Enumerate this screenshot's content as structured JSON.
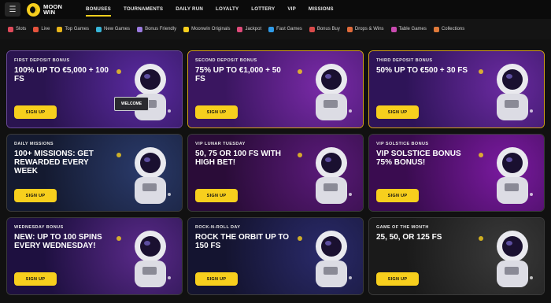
{
  "nav": {
    "logo_line1": "MOON",
    "logo_line2": "WIN",
    "menu_icon": "☰",
    "items": [
      "BONUSES",
      "TOURNAMENTS",
      "DAILY RUN",
      "LOYALTY",
      "LOTTERY",
      "VIP",
      "MISSIONS"
    ],
    "active_index": 0
  },
  "categories": [
    {
      "label": "Slots",
      "icon": "slots-icon",
      "color": "#e04a5a"
    },
    {
      "label": "Live",
      "icon": "live-icon",
      "color": "#e5533d"
    },
    {
      "label": "Top Games",
      "icon": "top-games-icon",
      "color": "#e8b51a"
    },
    {
      "label": "New Games",
      "icon": "new-games-icon",
      "color": "#38b6d8"
    },
    {
      "label": "Bonus Friendly",
      "icon": "bonus-friendly-icon",
      "color": "#9b7ae0"
    },
    {
      "label": "Moonwin Originals",
      "icon": "moonwin-originals-icon",
      "color": "#f7cf1d"
    },
    {
      "label": "Jackpot",
      "icon": "jackpot-icon",
      "color": "#e04a7a"
    },
    {
      "label": "Fast Games",
      "icon": "fast-games-icon",
      "color": "#2f9be8"
    },
    {
      "label": "Bonus Buy",
      "icon": "bonus-buy-icon",
      "color": "#d94a4a"
    },
    {
      "label": "Drops & Wins",
      "icon": "drops-wins-icon",
      "color": "#e06a3a"
    },
    {
      "label": "Table Games",
      "icon": "table-games-icon",
      "color": "#c94ab0"
    },
    {
      "label": "Collections",
      "icon": "collections-icon",
      "color": "#e07a3a"
    }
  ],
  "cards": [
    {
      "subtitle": "FIRST DEPOSIT BONUS",
      "title": "100% UP TO €5,000 + 100 FS",
      "button": "SIGN UP",
      "art_label": "WELCOME",
      "bg": "#5a2aa0",
      "bg2": "#2a1450",
      "border": "#6a4a9a"
    },
    {
      "subtitle": "SECOND DEPOSIT BONUS",
      "title": "75% UP TO €1,000 + 50 FS",
      "button": "SIGN UP",
      "art_label": "",
      "bg": "#7a2aa8",
      "bg2": "#3a1660",
      "border": "#d2a01a"
    },
    {
      "subtitle": "THIRD DEPOSIT BONUS",
      "title": "50% UP TO €500 + 30 FS",
      "button": "SIGN UP",
      "art_label": "",
      "bg": "#6a2aa0",
      "bg2": "#2e1458",
      "border": "#d2a01a"
    },
    {
      "subtitle": "DAILY MISSIONS",
      "title": "100+ MISSIONS: GET REWARDED EVERY WEEK",
      "button": "SIGN UP",
      "art_label": "",
      "bg": "#2a3a6a",
      "bg2": "#141a30",
      "border": "#3a3a3a"
    },
    {
      "subtitle": "VIP LUNAR TUESDAY",
      "title": "50, 75 OR 100 FS WITH HIGH BET!",
      "button": "SIGN UP",
      "art_label": "",
      "bg": "#5a1a7a",
      "bg2": "#2a0c38",
      "border": "#3a3a3a"
    },
    {
      "subtitle": "VIP SOLSTICE BONUS",
      "title": "VIP SOLSTICE BONUS 75% BONUS!",
      "button": "SIGN UP",
      "art_label": "",
      "bg": "#7a1aa0",
      "bg2": "#3a0c50",
      "border": "#3a3a3a"
    },
    {
      "subtitle": "WEDNESDAY BONUS",
      "title": "NEW: UP TO 100 SPINS EVERY WEDNESDAY!",
      "button": "SIGN UP",
      "art_label": "",
      "bg": "#5a2a8a",
      "bg2": "#1e1040",
      "border": "#3a3a3a"
    },
    {
      "subtitle": "ROCK-N-ROLL DAY",
      "title": "ROCK THE ORBIT UP TO 150 FS",
      "button": "SIGN UP",
      "art_label": "",
      "bg": "#2a2a6a",
      "bg2": "#141430",
      "border": "#3a3a3a"
    },
    {
      "subtitle": "GAME OF THE MONTH",
      "title": "25, 50, OR 125 FS",
      "button": "SIGN UP",
      "art_label": "",
      "bg": "#3a3a3a",
      "bg2": "#1a1a1a",
      "border": "#3a3a3a"
    }
  ]
}
